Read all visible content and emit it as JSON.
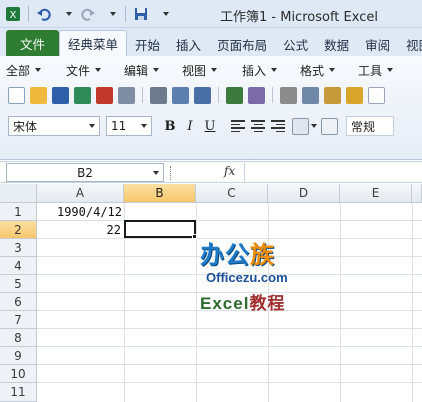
{
  "window": {
    "title": "工作簿1 - Microsoft Excel"
  },
  "ribbon_tabs": [
    {
      "label": "文件"
    },
    {
      "label": "经典菜单"
    },
    {
      "label": "开始"
    },
    {
      "label": "插入"
    },
    {
      "label": "页面布局"
    },
    {
      "label": "公式"
    },
    {
      "label": "数据"
    },
    {
      "label": "审阅"
    },
    {
      "label": "视图"
    }
  ],
  "classic_menu": [
    {
      "label": "全部"
    },
    {
      "label": "文件"
    },
    {
      "label": "编辑"
    },
    {
      "label": "视图"
    },
    {
      "label": "插入"
    },
    {
      "label": "格式"
    },
    {
      "label": "工具"
    }
  ],
  "format": {
    "font_name": "宋体",
    "font_size": "11",
    "bold": "B",
    "italic": "I",
    "underline": "U",
    "number_format": "常规"
  },
  "formula_bar": {
    "name_box": "B2",
    "fx": "fx",
    "content": ""
  },
  "sheet": {
    "columns": [
      "A",
      "B",
      "C",
      "D",
      "E"
    ],
    "rows": [
      "1",
      "2",
      "3",
      "4",
      "5",
      "6",
      "7",
      "8",
      "9",
      "10",
      "11"
    ],
    "selected_column": "B",
    "selected_row": "2",
    "cells": {
      "A1": "1990/4/12",
      "A2": "22"
    }
  },
  "watermark": {
    "logo_main": "办公",
    "logo_accent": "族",
    "site": "Officezu.com",
    "excel": "Excel",
    "excel_suffix": "教程"
  },
  "colors": {
    "file_tab": "#2e7d32",
    "selection_header": "#f6c76a",
    "watermark_blue": "#1f7ac7",
    "watermark_orange": "#f08c00"
  }
}
